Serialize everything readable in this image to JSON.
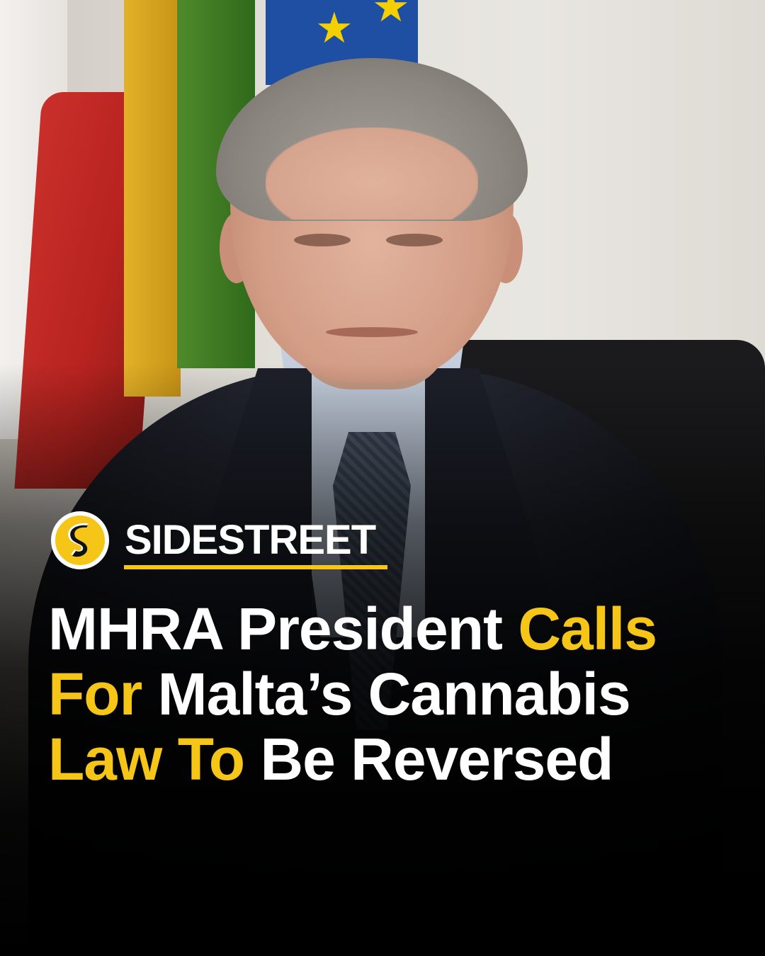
{
  "brand": {
    "name": "SIDESTREET",
    "logo_icon": "sidestreet-s-logo-icon",
    "accent_color": "#f5c518"
  },
  "headline": {
    "line1": {
      "white": "MHRA President ",
      "yellow": "Calls"
    },
    "line2": {
      "yellow": "For ",
      "white": "Malta’s Cannabis"
    },
    "line3": {
      "yellow": "Law To ",
      "white": "Be Reversed"
    }
  },
  "colors": {
    "accent": "#f5c518",
    "text": "#ffffff",
    "background": "#000000"
  }
}
